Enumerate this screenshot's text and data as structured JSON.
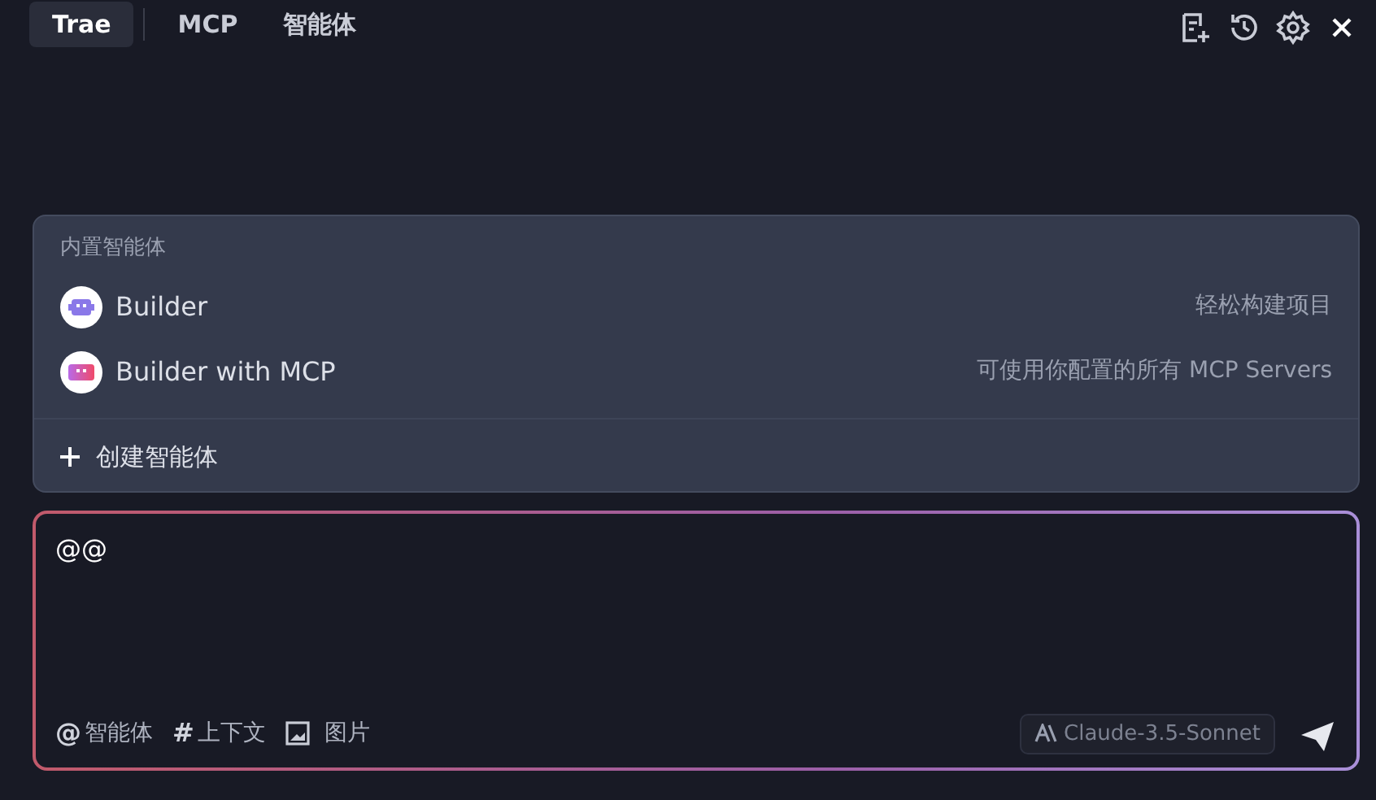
{
  "tabs": [
    {
      "label": "Trae",
      "selected": true
    },
    {
      "label": "MCP",
      "selected": false
    },
    {
      "label": "智能体",
      "selected": false
    }
  ],
  "agent_menu": {
    "section_title": "内置智能体",
    "items": [
      {
        "name": "Builder",
        "description": "轻松构建项目",
        "kind": "builder"
      },
      {
        "name": "Builder with MCP",
        "description": "可使用你配置的所有 MCP Servers",
        "kind": "mcp"
      }
    ],
    "create_label": "创建智能体"
  },
  "input": {
    "value": "@@",
    "tools": [
      {
        "kind": "symbol",
        "symbol": "@",
        "label": "智能体"
      },
      {
        "kind": "symbol",
        "symbol": "#",
        "label": "上下文"
      },
      {
        "kind": "image",
        "label": "图片"
      }
    ],
    "model": "Claude-3.5-Sonnet"
  }
}
